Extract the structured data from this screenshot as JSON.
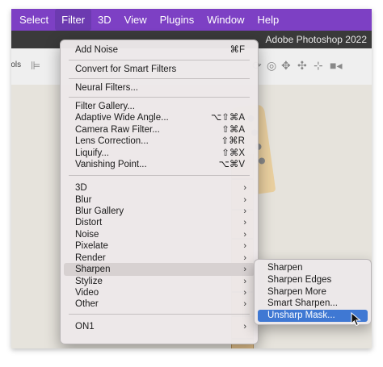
{
  "menubar": {
    "items": [
      "Select",
      "Filter",
      "3D",
      "View",
      "Plugins",
      "Window",
      "Help"
    ],
    "active": "Filter"
  },
  "app": {
    "title": "Adobe Photoshop 2022"
  },
  "optionsbar": {
    "partial_label": "rols"
  },
  "filter_menu": {
    "top": [
      {
        "label": "Add Noise",
        "shortcut": "⌘F"
      }
    ],
    "convert": {
      "label": "Convert for Smart Filters"
    },
    "neural": {
      "label": "Neural Filters..."
    },
    "galleries": [
      {
        "label": "Filter Gallery...",
        "shortcut": ""
      },
      {
        "label": "Adaptive Wide Angle...",
        "shortcut": "⌥⇧⌘A"
      },
      {
        "label": "Camera Raw Filter...",
        "shortcut": "⇧⌘A"
      },
      {
        "label": "Lens Correction...",
        "shortcut": "⇧⌘R"
      },
      {
        "label": "Liquify...",
        "shortcut": "⇧⌘X"
      },
      {
        "label": "Vanishing Point...",
        "shortcut": "⌥⌘V"
      }
    ],
    "submenus": [
      "3D",
      "Blur",
      "Blur Gallery",
      "Distort",
      "Noise",
      "Pixelate",
      "Render",
      "Sharpen",
      "Stylize",
      "Video",
      "Other"
    ],
    "highlighted": "Sharpen",
    "plugin": "ON1",
    "arrow_glyph": "›"
  },
  "sharpen_submenu": {
    "items": [
      "Sharpen",
      "Sharpen Edges",
      "Sharpen More",
      "Smart Sharpen...",
      "Unsharp Mask..."
    ],
    "selected": "Unsharp Mask..."
  },
  "colors": {
    "menubar": "#7d40c4",
    "selection": "#3f78d3"
  }
}
